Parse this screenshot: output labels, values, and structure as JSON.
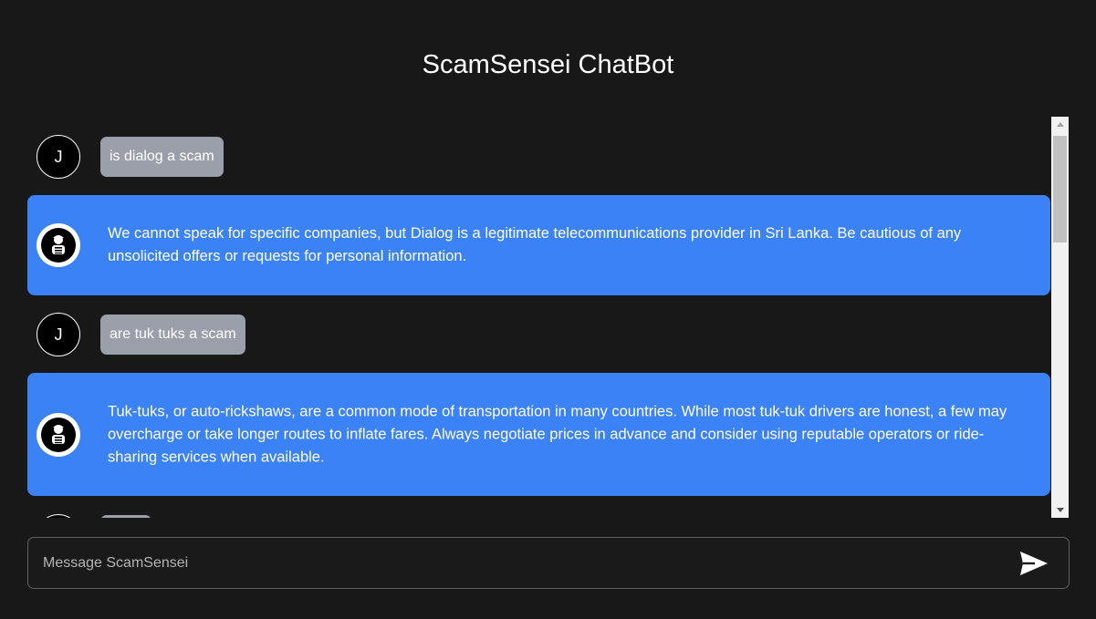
{
  "app": {
    "title": "ScamSensei ChatBot"
  },
  "messages": [
    {
      "role": "user",
      "avatar_letter": "J",
      "text": "is dialog a scam"
    },
    {
      "role": "bot",
      "avatar_icon": "scam-sensei-bot-icon",
      "text": "We cannot speak for specific companies, but Dialog is a legitimate telecommunications provider in Sri Lanka. Be cautious of any unsolicited offers or requests for personal information."
    },
    {
      "role": "user",
      "avatar_letter": "J",
      "text": "are tuk tuks a scam"
    },
    {
      "role": "bot",
      "avatar_icon": "scam-sensei-bot-icon",
      "text": "Tuk-tuks, or auto-rickshaws, are a common mode of transportation in many countries. While most tuk-tuk drivers are honest, a few may overcharge or take longer routes to inflate fares. Always negotiate prices in advance and consider using reputable operators or ride-sharing services when available."
    }
  ],
  "composer": {
    "placeholder": "Message ScamSensei",
    "value": "",
    "send_icon": "send-icon"
  },
  "colors": {
    "background": "#181818",
    "bot_bubble": "#3b82f6",
    "user_bubble": "#9b9fa9",
    "scrollbar_track": "#f1f1f1",
    "scrollbar_thumb": "#c1c1c1"
  }
}
